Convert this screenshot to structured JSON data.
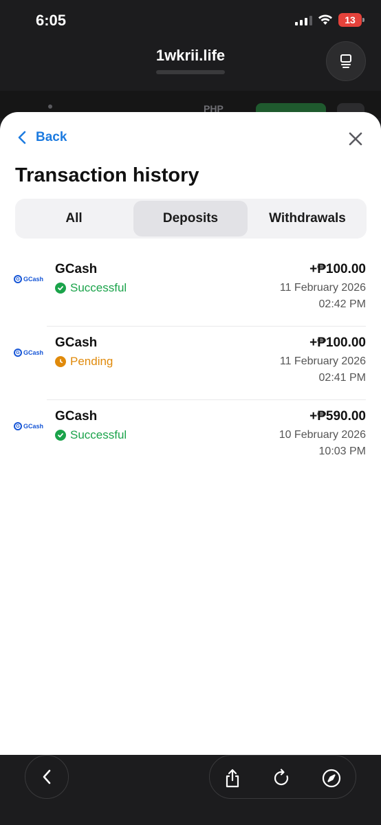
{
  "status_bar": {
    "time": "6:05",
    "battery": "13"
  },
  "browser": {
    "url": "1wkrii.life"
  },
  "background": {
    "currency": "PHP"
  },
  "sheet": {
    "back_label": "Back",
    "title": "Transaction history",
    "tabs": [
      {
        "label": "All",
        "active": false
      },
      {
        "label": "Deposits",
        "active": true
      },
      {
        "label": "Withdrawals",
        "active": false
      }
    ],
    "transactions": [
      {
        "logo": "GCash",
        "method": "GCash",
        "status": "Successful",
        "amount": "+₱100.00",
        "date": "11 February 2026",
        "time": "02:42 PM"
      },
      {
        "logo": "GCash",
        "method": "GCash",
        "status": "Pending",
        "amount": "+₱100.00",
        "date": "11 February 2026",
        "time": "02:41 PM"
      },
      {
        "logo": "GCash",
        "method": "GCash",
        "status": "Successful",
        "amount": "+₱590.00",
        "date": "10 February 2026",
        "time": "10:03 PM"
      }
    ]
  },
  "colors": {
    "accent": "#1d7be0",
    "success": "#1aa34a",
    "pending": "#e08a0b",
    "gcash_blue": "#1555d6"
  },
  "icons": {
    "signal": "cellular-signal-icon",
    "wifi": "wifi-icon",
    "tabs": "tabs-icon",
    "back": "chevron-left-icon",
    "close": "close-icon",
    "success": "check-circle-icon",
    "pending": "clock-icon",
    "share": "share-icon",
    "reload": "reload-icon",
    "compass": "compass-icon"
  }
}
